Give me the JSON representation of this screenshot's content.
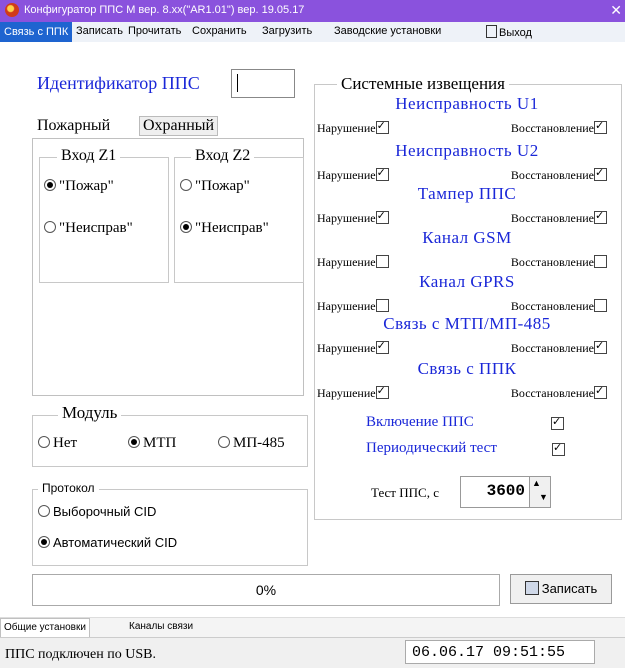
{
  "window": {
    "title": "Конфигуратор ППС М вер. 8.xx(\"AR1.01\") вер. 19.05.17",
    "close_glyph": "✕"
  },
  "menu": {
    "items": [
      "Связь с ППК",
      "Записать",
      "Прочитать",
      "Сохранить",
      "Загрузить",
      "Заводские установки",
      "Выход"
    ]
  },
  "identifier": {
    "label": "Идентификатор ППС",
    "value": ""
  },
  "input_tabs": {
    "tabs": [
      "Пожарный",
      "Охранный"
    ],
    "selected": "Пожарный"
  },
  "inputs": [
    {
      "title": "Вход Z1",
      "options": [
        "\"Пожар\"",
        "\"Неисправ\""
      ],
      "selected": "\"Пожар\""
    },
    {
      "title": "Вход Z2",
      "options": [
        "\"Пожар\"",
        "\"Неисправ\""
      ],
      "selected": "\"Неисправ\""
    }
  ],
  "module": {
    "title": "Модуль",
    "options": [
      "Нет",
      "МТП",
      "МП-485"
    ],
    "selected": "МТП"
  },
  "protocol": {
    "title": "Протокол",
    "options": [
      "Выборочный CID",
      "Автоматический CID"
    ],
    "selected": "Автоматический CID"
  },
  "system_notifications": {
    "title": "Системные извещения",
    "violation_label": "Нарушение",
    "restore_label": "Восстановление",
    "items": [
      {
        "name": "Неисправность U1",
        "violation": true,
        "restore": true
      },
      {
        "name": "Неисправность U2",
        "violation": true,
        "restore": true
      },
      {
        "name": "Тампер ППС",
        "violation": true,
        "restore": true
      },
      {
        "name": "Канал GSM",
        "violation": false,
        "restore": false
      },
      {
        "name": "Канал GPRS",
        "violation": false,
        "restore": false
      },
      {
        "name": "Связь с МТП/МП-485",
        "violation": true,
        "restore": true
      },
      {
        "name": "Связь с ППК",
        "violation": true,
        "restore": true
      }
    ],
    "pps_on": {
      "label": "Включение ППС",
      "checked": true
    },
    "periodic_test": {
      "label": "Периодический тест",
      "checked": true
    },
    "test_period": {
      "label": "Тест ППС,  с",
      "value": "3600"
    }
  },
  "progress": {
    "text": "0%",
    "value": 0
  },
  "write_button": {
    "label": "Записать"
  },
  "bottom_tabs": [
    "Общие установки",
    "Каналы связи"
  ],
  "status": {
    "message": "ППС подключен по USB.",
    "datetime": "06.06.17  09:51:55"
  },
  "colors": {
    "title_bar": "#8a52dd",
    "menu_active": "#1e64d0",
    "section_text": "#1a27d8"
  }
}
